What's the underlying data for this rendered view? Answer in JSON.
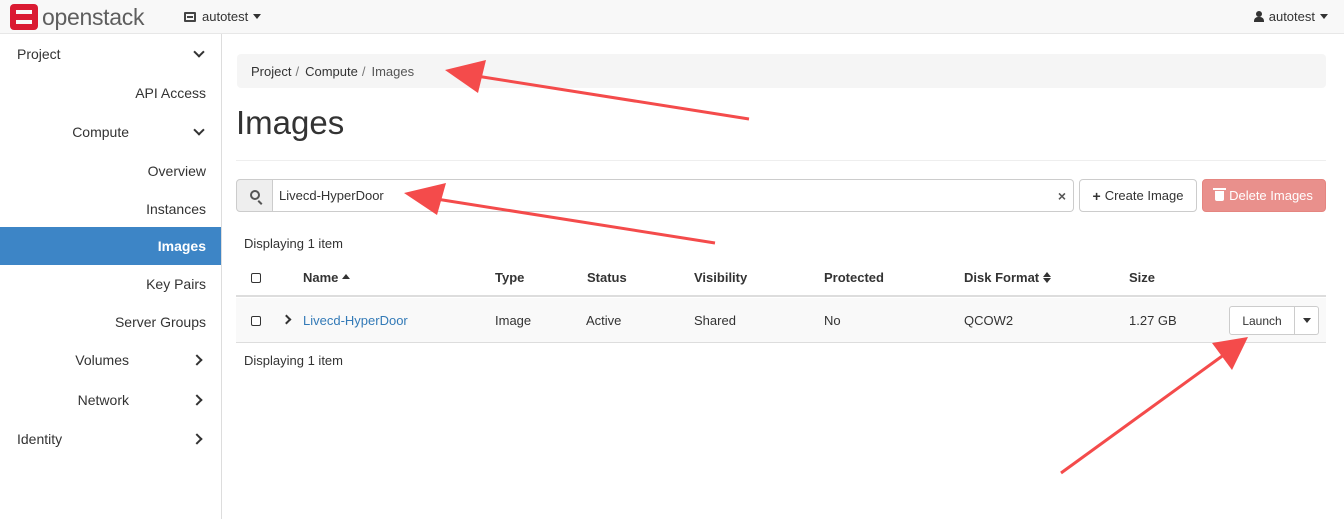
{
  "navbar": {
    "brand": "openstack",
    "project_label": "autotest",
    "user_label": "autotest"
  },
  "sidebar": {
    "items": [
      {
        "label": "Project",
        "level": 1,
        "expanded": true
      },
      {
        "label": "API Access",
        "level": 3
      },
      {
        "label": "Compute",
        "level": 2,
        "expanded": true
      },
      {
        "label": "Overview",
        "level": 3
      },
      {
        "label": "Instances",
        "level": 3
      },
      {
        "label": "Images",
        "level": 3,
        "active": true
      },
      {
        "label": "Key Pairs",
        "level": 3
      },
      {
        "label": "Server Groups",
        "level": 3
      },
      {
        "label": "Volumes",
        "level": 2,
        "expanded": false
      },
      {
        "label": "Network",
        "level": 2,
        "expanded": false
      },
      {
        "label": "Identity",
        "level": 1,
        "expanded": false
      }
    ]
  },
  "breadcrumb": [
    "Project",
    "Compute",
    "Images"
  ],
  "page_title": "Images",
  "filter": {
    "value": "Livecd-HyperDoor",
    "clear_icon": "×"
  },
  "actions": {
    "create_label": "Create Image",
    "delete_label": "Delete Images",
    "delete_color": "#e9908c"
  },
  "table": {
    "count_top": "Displaying 1 item",
    "count_bottom": "Displaying 1 item",
    "headers": {
      "name": "Name",
      "type": "Type",
      "status": "Status",
      "visibility": "Visibility",
      "protected": "Protected",
      "disk_format": "Disk Format",
      "size": "Size"
    },
    "rows": [
      {
        "name": "Livecd-HyperDoor",
        "type": "Image",
        "status": "Active",
        "visibility": "Shared",
        "protected": "No",
        "disk_format": "QCOW2",
        "size": "1.27 GB",
        "action_label": "Launch"
      }
    ]
  },
  "colors": {
    "sidebar_active": "#3d85c6",
    "link": "#337ab7",
    "annotation_arrow": "#f44b4b"
  }
}
